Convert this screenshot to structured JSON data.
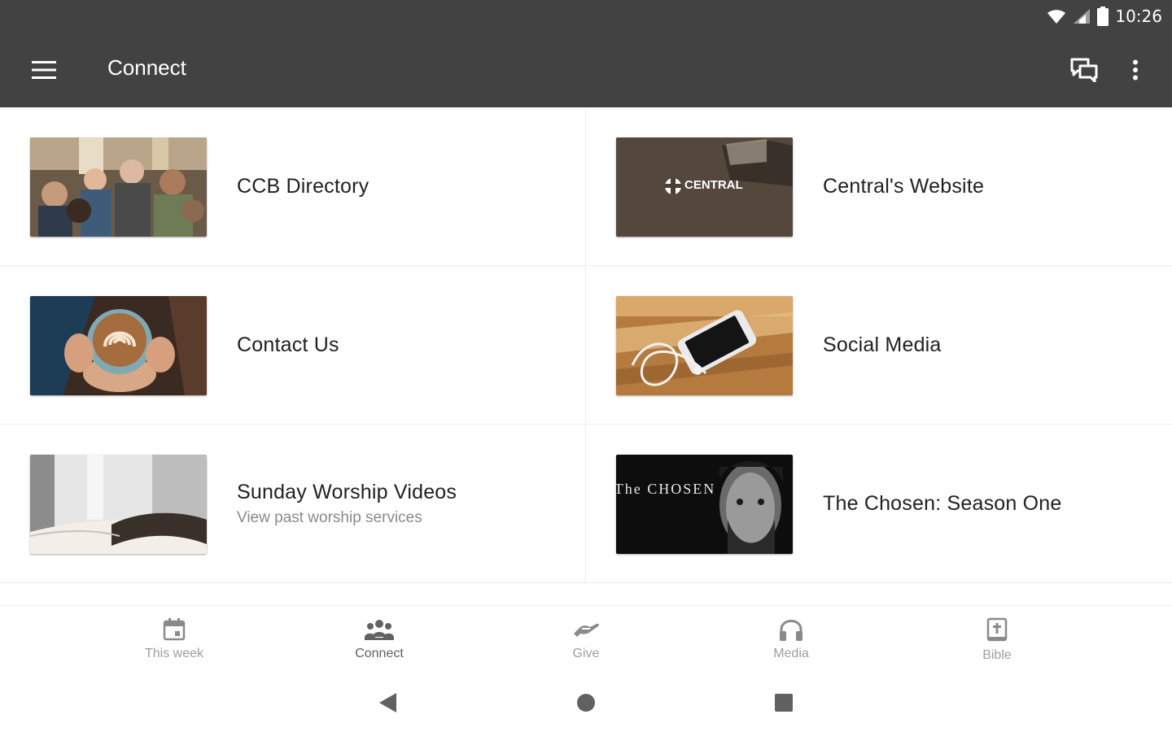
{
  "status_bar": {
    "time": "10:26",
    "icons": [
      "wifi-icon",
      "signal-icon",
      "battery-icon"
    ]
  },
  "app_bar": {
    "title": "Connect",
    "menu_icon": "hamburger-menu-icon",
    "actions": [
      "chat-icon",
      "more-vert-icon"
    ]
  },
  "colors": {
    "app_bar": "#424242",
    "background": "#ffffff",
    "title_text": "#212121",
    "subtitle_text": "#8a8a8a",
    "nav_inactive": "#9e9e9e"
  },
  "items": [
    {
      "title": "CCB Directory",
      "subtitle": "",
      "image": "group-of-people-photo"
    },
    {
      "title": "Central's Website",
      "subtitle": "",
      "image": "central-logo-wood-photo",
      "image_text": "CENTRAL"
    },
    {
      "title": "Contact Us",
      "subtitle": "",
      "image": "latte-cup-photo"
    },
    {
      "title": "Social Media",
      "subtitle": "",
      "image": "phone-earbuds-photo"
    },
    {
      "title": "Sunday Worship Videos",
      "subtitle": "View past worship services",
      "image": "open-bible-photo"
    },
    {
      "title": "The Chosen: Season One",
      "subtitle": "",
      "image": "the-chosen-poster",
      "image_text": "The CHOSEN"
    }
  ],
  "bottom_nav": [
    {
      "label": "This week",
      "icon": "calendar-icon",
      "active": false
    },
    {
      "label": "Connect",
      "icon": "people-icon",
      "active": true
    },
    {
      "label": "Give",
      "icon": "give-hand-icon",
      "active": false
    },
    {
      "label": "Media",
      "icon": "headphones-icon",
      "active": false
    },
    {
      "label": "Bible",
      "icon": "bible-icon",
      "active": false
    }
  ],
  "system_nav": [
    "back-icon",
    "home-icon",
    "recents-icon"
  ]
}
